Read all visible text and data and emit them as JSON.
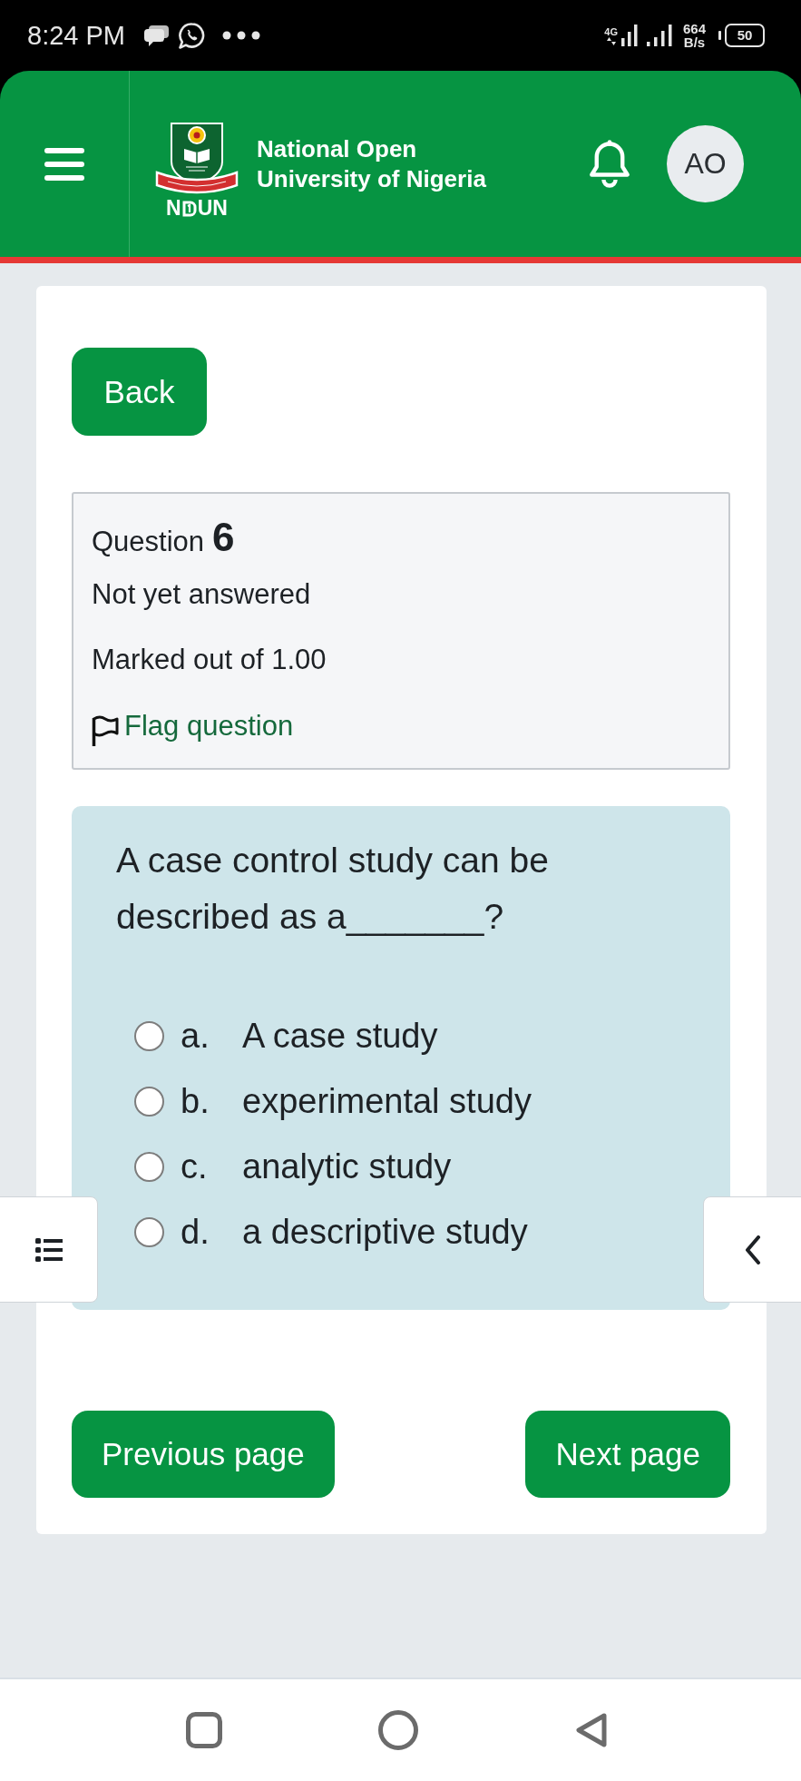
{
  "status_bar": {
    "time": "8:24 PM",
    "network": "4G",
    "speed_value": "664",
    "speed_unit": "B/s",
    "battery": "50"
  },
  "header": {
    "title_lines": [
      "National Open",
      "University of Nigeria"
    ],
    "logo_before": "N",
    "logo_after": "UN",
    "avatar": "AO"
  },
  "back_button": "Back",
  "question_info": {
    "label": "Question",
    "number": "6",
    "status": "Not yet answered",
    "mark": "Marked out of 1.00",
    "flag_label": "Flag question",
    "flagged": false
  },
  "question": {
    "text": "A case control study can be described as a_______?",
    "options": [
      {
        "letter": "a.",
        "text": "A case study",
        "selected": false
      },
      {
        "letter": "b.",
        "text": "experimental study",
        "selected": false
      },
      {
        "letter": "c.",
        "text": "analytic study",
        "selected": false
      },
      {
        "letter": "d.",
        "text": "a descriptive study",
        "selected": false
      }
    ]
  },
  "navigation": {
    "previous": "Previous page",
    "next": "Next page"
  }
}
